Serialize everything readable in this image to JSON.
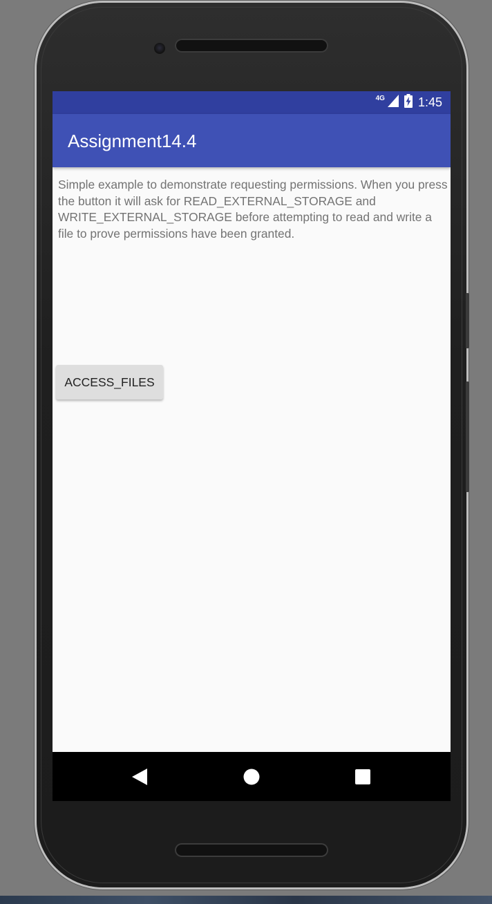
{
  "statusbar": {
    "network_label": "4G",
    "time": "1:45",
    "icons": [
      "signal-icon",
      "battery-charging-icon"
    ]
  },
  "appbar": {
    "title": "Assignment14.4"
  },
  "main": {
    "description": "Simple example to demonstrate requesting permissions. When you press the button it will ask for READ_EXTERNAL_STORAGE and WRITE_EXTERNAL_STORAGE before attempting to read and write a file to prove permissions have been granted.",
    "button_label": "ACCESS_FILES"
  },
  "navbar": {
    "icons": [
      "back-icon",
      "home-icon",
      "recents-icon"
    ]
  },
  "colors": {
    "status_bar": "#303f9f",
    "app_bar": "#3f51b5",
    "background": "#fafafa",
    "body_text": "#737373",
    "button": "#dedede",
    "nav_bar": "#000000"
  }
}
